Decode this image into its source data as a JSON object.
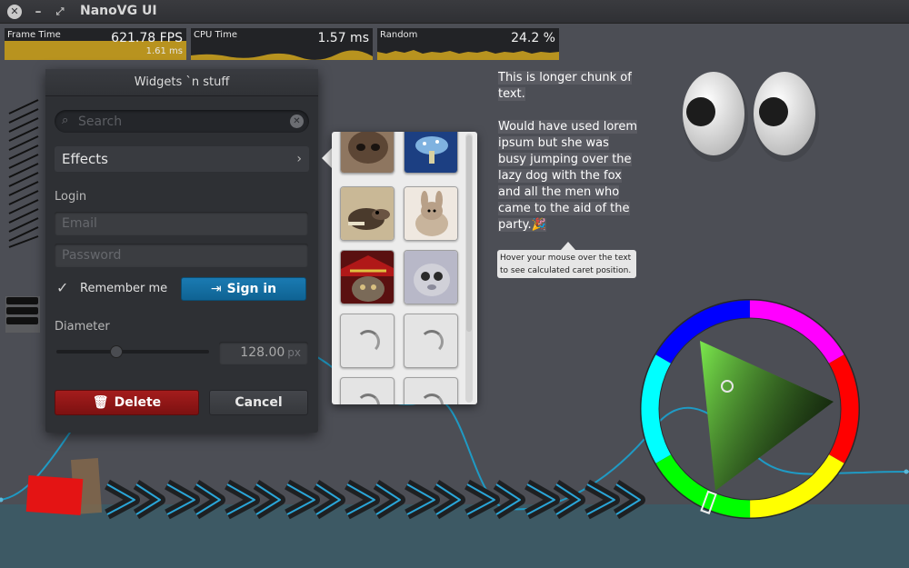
{
  "app": {
    "title": "NanoVG UI"
  },
  "titlebar": {
    "close_icon": "close-icon",
    "minimize_icon": "minimize-icon",
    "maximize_icon": "maximize-icon"
  },
  "graphs": {
    "frame_time": {
      "label": "Frame Time",
      "value": "621.78 FPS",
      "sub": "1.61 ms",
      "color": "#b8931f"
    },
    "cpu_time": {
      "label": "CPU Time",
      "value": "1.57 ms",
      "color": "#b8931f"
    },
    "random": {
      "label": "Random",
      "value": "24.2 %",
      "color": "#b8931f"
    }
  },
  "window": {
    "title": "Widgets `n stuff",
    "search": {
      "placeholder": "Search"
    },
    "effects_label": "Effects",
    "login_label": "Login",
    "email": {
      "placeholder": "Email"
    },
    "password": {
      "placeholder": "Password"
    },
    "remember_label": "Remember me",
    "remember_checked": true,
    "signin_label": "Sign in",
    "diameter_label": "Diameter",
    "diameter_value": "128.00",
    "diameter_unit": "px",
    "slider_value_fraction": 0.4,
    "delete_label": "Delete",
    "cancel_label": "Cancel"
  },
  "thumbnails": {
    "items": [
      {
        "name": "dog-nose",
        "state": "image"
      },
      {
        "name": "blue-mushroom",
        "state": "image"
      },
      {
        "name": "shrew",
        "state": "image"
      },
      {
        "name": "bunny",
        "state": "image"
      },
      {
        "name": "pirate-cat",
        "state": "image"
      },
      {
        "name": "furry-creature",
        "state": "image"
      },
      {
        "name": "loading",
        "state": "loading"
      },
      {
        "name": "loading",
        "state": "loading"
      },
      {
        "name": "loading",
        "state": "loading"
      },
      {
        "name": "loading",
        "state": "loading"
      }
    ]
  },
  "paragraph": {
    "lines": [
      "This is longer chunk of",
      "text.",
      "",
      "Would have used lorem",
      "ipsum but she    was",
      "busy jumping over the",
      "lazy dog with the fox",
      "and all the men who",
      "came to the aid of the",
      "party.🎉"
    ],
    "tooltip": "Hover your mouse over the text to see calculated caret position."
  },
  "colors": {
    "background": "#4c4e55",
    "accent_blue": "#1a7ab2",
    "delete_red": "#a41c1c",
    "curve": "#1f9ac4"
  }
}
